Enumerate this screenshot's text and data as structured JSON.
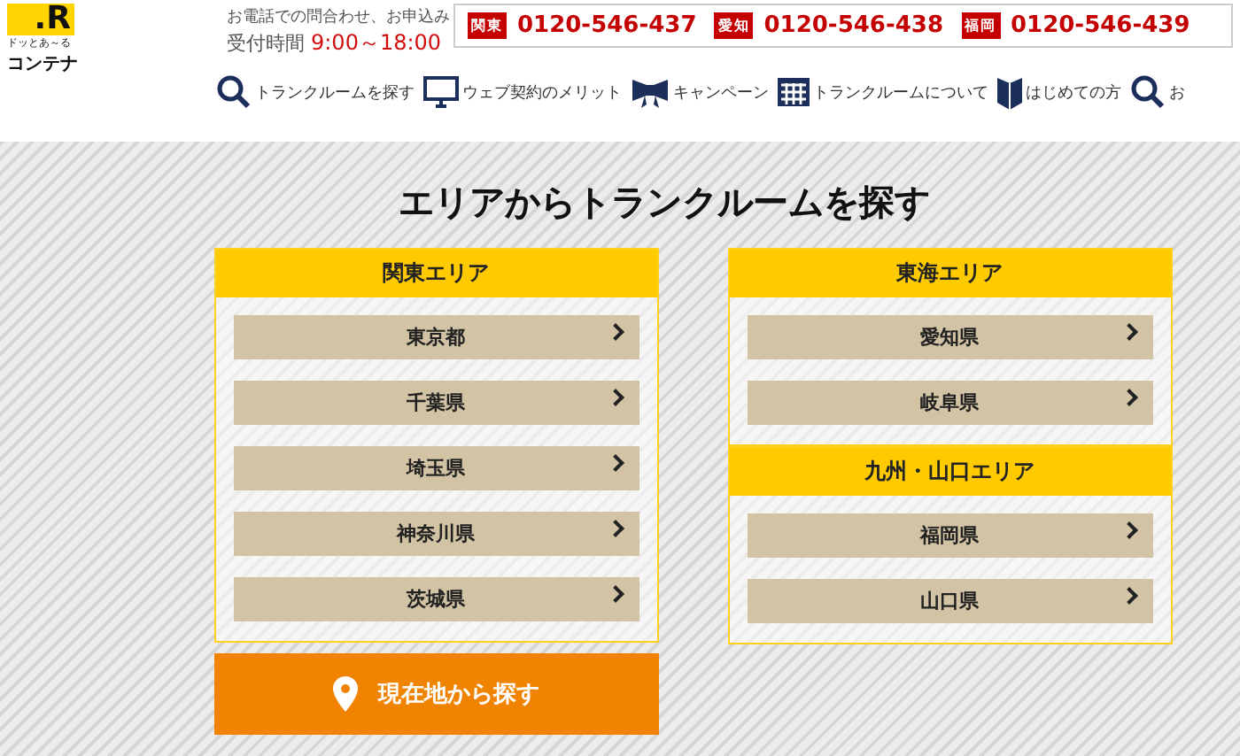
{
  "header": {
    "logo": {
      "mark": ".R",
      "tagline": "ドッとあ～る",
      "name": "コンテナ"
    },
    "contact_note": "お電話での問合わせ、お申込み",
    "hours_label": "受付時間",
    "hours": "9:00～18:00",
    "phones": [
      {
        "region": "関東",
        "number": "0120-546-437"
      },
      {
        "region": "愛知",
        "number": "0120-546-438"
      },
      {
        "region": "福岡",
        "number": "0120-546-439"
      }
    ]
  },
  "nav": [
    {
      "kind": "search",
      "label": "トランクルームを探す"
    },
    {
      "kind": "monitor",
      "label": "ウェブ契約のメリット"
    },
    {
      "kind": "ribbon",
      "label": "キャンペーン"
    },
    {
      "kind": "grid",
      "label": "トランクルームについて"
    },
    {
      "kind": "leaf",
      "label": "はじめての方"
    },
    {
      "kind": "search",
      "label": "お"
    }
  ],
  "main": {
    "title": "エリアからトランクルームを探す",
    "columns": [
      [
        {
          "title": "関東エリア",
          "items": [
            "東京都",
            "千葉県",
            "埼玉県",
            "神奈川県",
            "茨城県"
          ]
        }
      ],
      [
        {
          "title": "東海エリア",
          "items": [
            "愛知県",
            "岐阜県"
          ]
        },
        {
          "title": "九州・山口エリア",
          "items": [
            "福岡県",
            "山口県"
          ]
        }
      ]
    ],
    "locate_button": "現在地から探す"
  }
}
